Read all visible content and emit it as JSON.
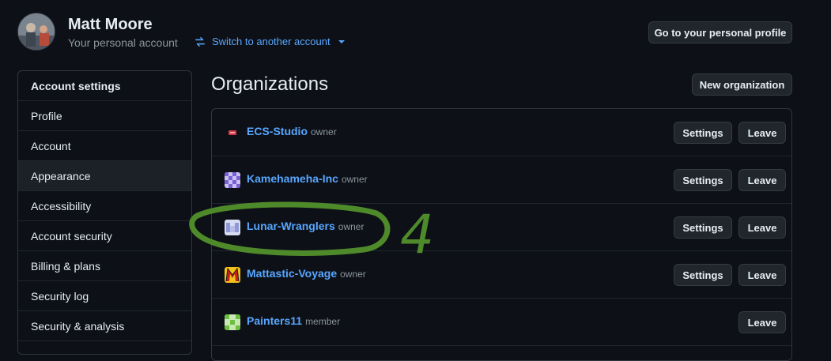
{
  "header": {
    "user_name": "Matt Moore",
    "subtitle": "Your personal account",
    "switch_label": "Switch to another account",
    "profile_button": "Go to your personal profile"
  },
  "sidebar": {
    "heading": "Account settings",
    "items": [
      {
        "label": "Profile"
      },
      {
        "label": "Account"
      },
      {
        "label": "Appearance"
      },
      {
        "label": "Accessibility"
      },
      {
        "label": "Account security"
      },
      {
        "label": "Billing & plans"
      },
      {
        "label": "Security log"
      },
      {
        "label": "Security & analysis"
      }
    ],
    "active": "Appearance"
  },
  "main": {
    "title": "Organizations",
    "new_org_button": "New organization",
    "settings_label": "Settings",
    "leave_label": "Leave",
    "orgs": [
      {
        "name": "ECS-Studio",
        "role": "owner"
      },
      {
        "name": "Kamehameha-Inc",
        "role": "owner"
      },
      {
        "name": "Lunar-Wranglers",
        "role": "owner"
      },
      {
        "name": "Mattastic-Voyage",
        "role": "owner"
      },
      {
        "name": "Painters11",
        "role": "member"
      }
    ]
  },
  "annotation": {
    "number": "4",
    "color": "#4e8a2a"
  },
  "colors": {
    "background": "#0d1117",
    "link": "#58a6ff",
    "muted": "#8b949e"
  }
}
